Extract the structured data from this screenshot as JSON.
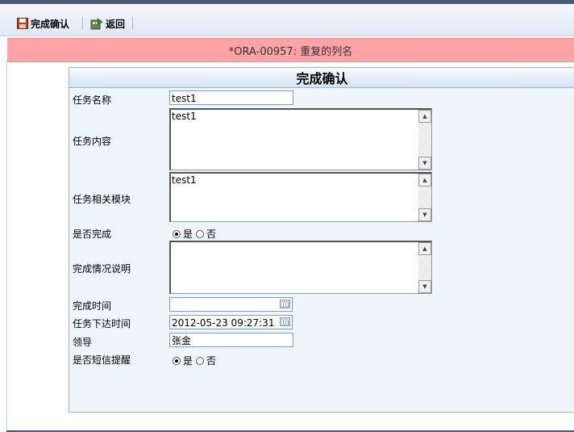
{
  "toolbar": {
    "confirm_label": "完成确认",
    "back_label": "返回"
  },
  "error": {
    "message": "*ORA-00957: 重复的列名"
  },
  "form": {
    "title": "完成确认",
    "task_name": {
      "label": "任务名称",
      "value": "test1"
    },
    "task_content": {
      "label": "任务内容",
      "value": "test1"
    },
    "task_module": {
      "label": "任务相关模块",
      "value": "test1"
    },
    "is_completed": {
      "label": "是否完成",
      "yes": "是",
      "no": "否",
      "selected": "是"
    },
    "completion_note": {
      "label": "完成情况说明",
      "value": ""
    },
    "completion_time": {
      "label": "完成时间",
      "value": ""
    },
    "assign_time": {
      "label": "任务下达时间",
      "value": "2012-05-23 09:27:31"
    },
    "leader": {
      "label": "领导",
      "value": "张金"
    },
    "sms_remind": {
      "label": "是否短信提醒",
      "yes": "是",
      "no": "否",
      "selected": "是"
    }
  },
  "colors": {
    "error_bg": "#ffa3a6",
    "panel_bg": "#eef5fb",
    "header_bar": "#4a5a78"
  }
}
